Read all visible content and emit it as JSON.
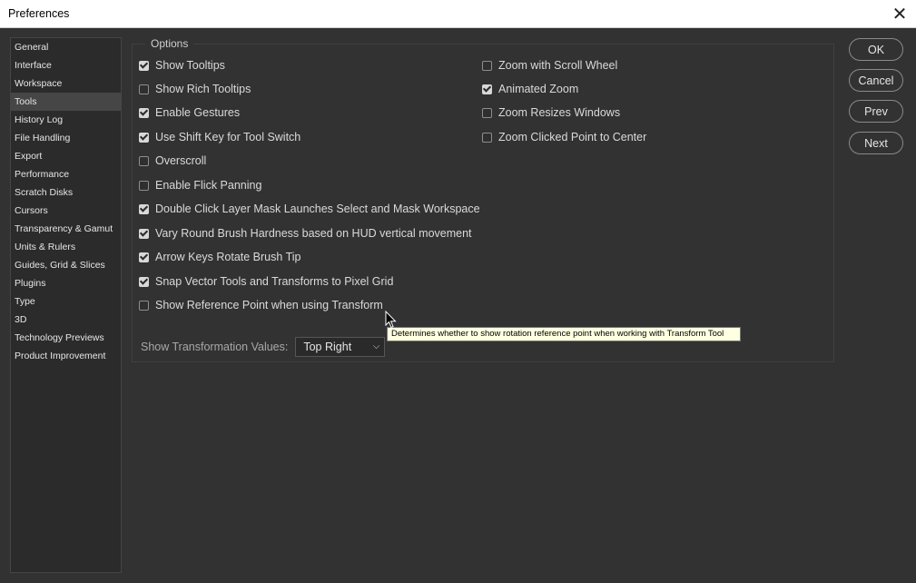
{
  "window": {
    "title": "Preferences"
  },
  "sidebar": {
    "items": [
      {
        "label": "General"
      },
      {
        "label": "Interface"
      },
      {
        "label": "Workspace"
      },
      {
        "label": "Tools"
      },
      {
        "label": "History Log"
      },
      {
        "label": "File Handling"
      },
      {
        "label": "Export"
      },
      {
        "label": "Performance"
      },
      {
        "label": "Scratch Disks"
      },
      {
        "label": "Cursors"
      },
      {
        "label": "Transparency & Gamut"
      },
      {
        "label": "Units & Rulers"
      },
      {
        "label": "Guides, Grid & Slices"
      },
      {
        "label": "Plugins"
      },
      {
        "label": "Type"
      },
      {
        "label": "3D"
      },
      {
        "label": "Technology Previews"
      },
      {
        "label": "Product Improvement"
      }
    ],
    "active": "Tools"
  },
  "options": {
    "legend": "Options",
    "left": [
      {
        "label": "Show Tooltips",
        "checked": true
      },
      {
        "label": "Show Rich Tooltips",
        "checked": false
      },
      {
        "label": "Enable Gestures",
        "checked": true
      },
      {
        "label": "Use Shift Key for Tool Switch",
        "checked": true
      },
      {
        "label": "Overscroll",
        "checked": false
      },
      {
        "label": "Enable Flick Panning",
        "checked": false
      },
      {
        "label": "Double Click Layer Mask Launches Select and Mask Workspace",
        "checked": true
      },
      {
        "label": "Vary Round Brush Hardness based on HUD vertical movement",
        "checked": true
      },
      {
        "label": "Arrow Keys Rotate Brush Tip",
        "checked": true
      },
      {
        "label": "Snap Vector Tools and Transforms to Pixel Grid",
        "checked": true
      },
      {
        "label": "Show Reference Point when using Transform",
        "checked": false
      }
    ],
    "right": [
      {
        "label": "Zoom with Scroll Wheel",
        "checked": false
      },
      {
        "label": "Animated Zoom",
        "checked": true
      },
      {
        "label": "Zoom Resizes Windows",
        "checked": false
      },
      {
        "label": "Zoom Clicked Point to Center",
        "checked": false
      }
    ],
    "transformation": {
      "label": "Show Transformation Values:",
      "value": "Top Right"
    }
  },
  "buttons": {
    "ok": "OK",
    "cancel": "Cancel",
    "prev": "Prev",
    "next": "Next"
  },
  "tooltip": "Determines whether to show rotation reference point when working with Transform Tool"
}
